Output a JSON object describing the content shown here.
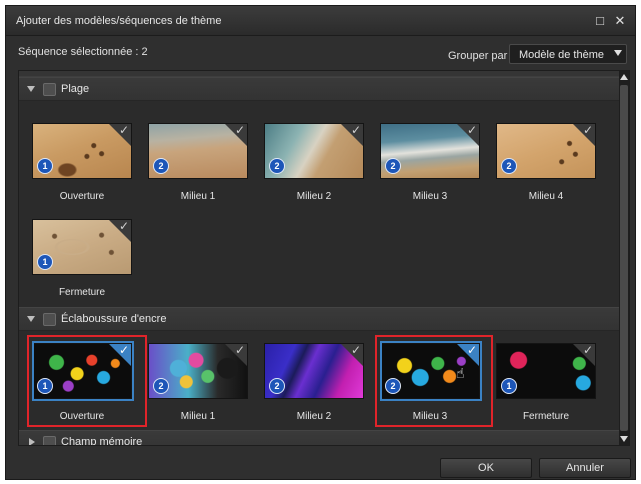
{
  "window": {
    "title": "Ajouter des modèles/séquences de thème",
    "maximize_icon": "maximize-icon",
    "close_icon": "close-icon"
  },
  "toolbar": {
    "selected_count_label": "Séquence sélectionnée : 2",
    "group_by_label": "Grouper par :",
    "group_by_value": "Modèle de thème"
  },
  "sections": [
    {
      "title": "Plage",
      "expanded": true,
      "items": [
        {
          "label": "Ouverture",
          "badge": "1",
          "selected": false
        },
        {
          "label": "Milieu 1",
          "badge": "2",
          "selected": false
        },
        {
          "label": "Milieu 2",
          "badge": "2",
          "selected": false
        },
        {
          "label": "Milieu 3",
          "badge": "2",
          "selected": false
        },
        {
          "label": "Milieu 4",
          "badge": "2",
          "selected": false
        },
        {
          "label": "Fermeture",
          "badge": "1",
          "selected": false
        }
      ]
    },
    {
      "title": "Éclaboussure d'encre",
      "expanded": true,
      "items": [
        {
          "label": "Ouverture",
          "badge": "1",
          "selected": true,
          "highlighted": true
        },
        {
          "label": "Milieu 1",
          "badge": "2",
          "selected": false
        },
        {
          "label": "Milieu 2",
          "badge": "2",
          "selected": false
        },
        {
          "label": "Milieu 3",
          "badge": "2",
          "selected": true,
          "highlighted": true
        },
        {
          "label": "Fermeture",
          "badge": "1",
          "selected": false
        }
      ]
    },
    {
      "title": "Champ mémoire",
      "expanded": false,
      "items": []
    }
  ],
  "buttons": {
    "ok": "OK",
    "cancel": "Annuler"
  },
  "colors": {
    "accent": "#3b82c4",
    "highlight_box": "#e0242a",
    "badge": "#1d56b8"
  }
}
